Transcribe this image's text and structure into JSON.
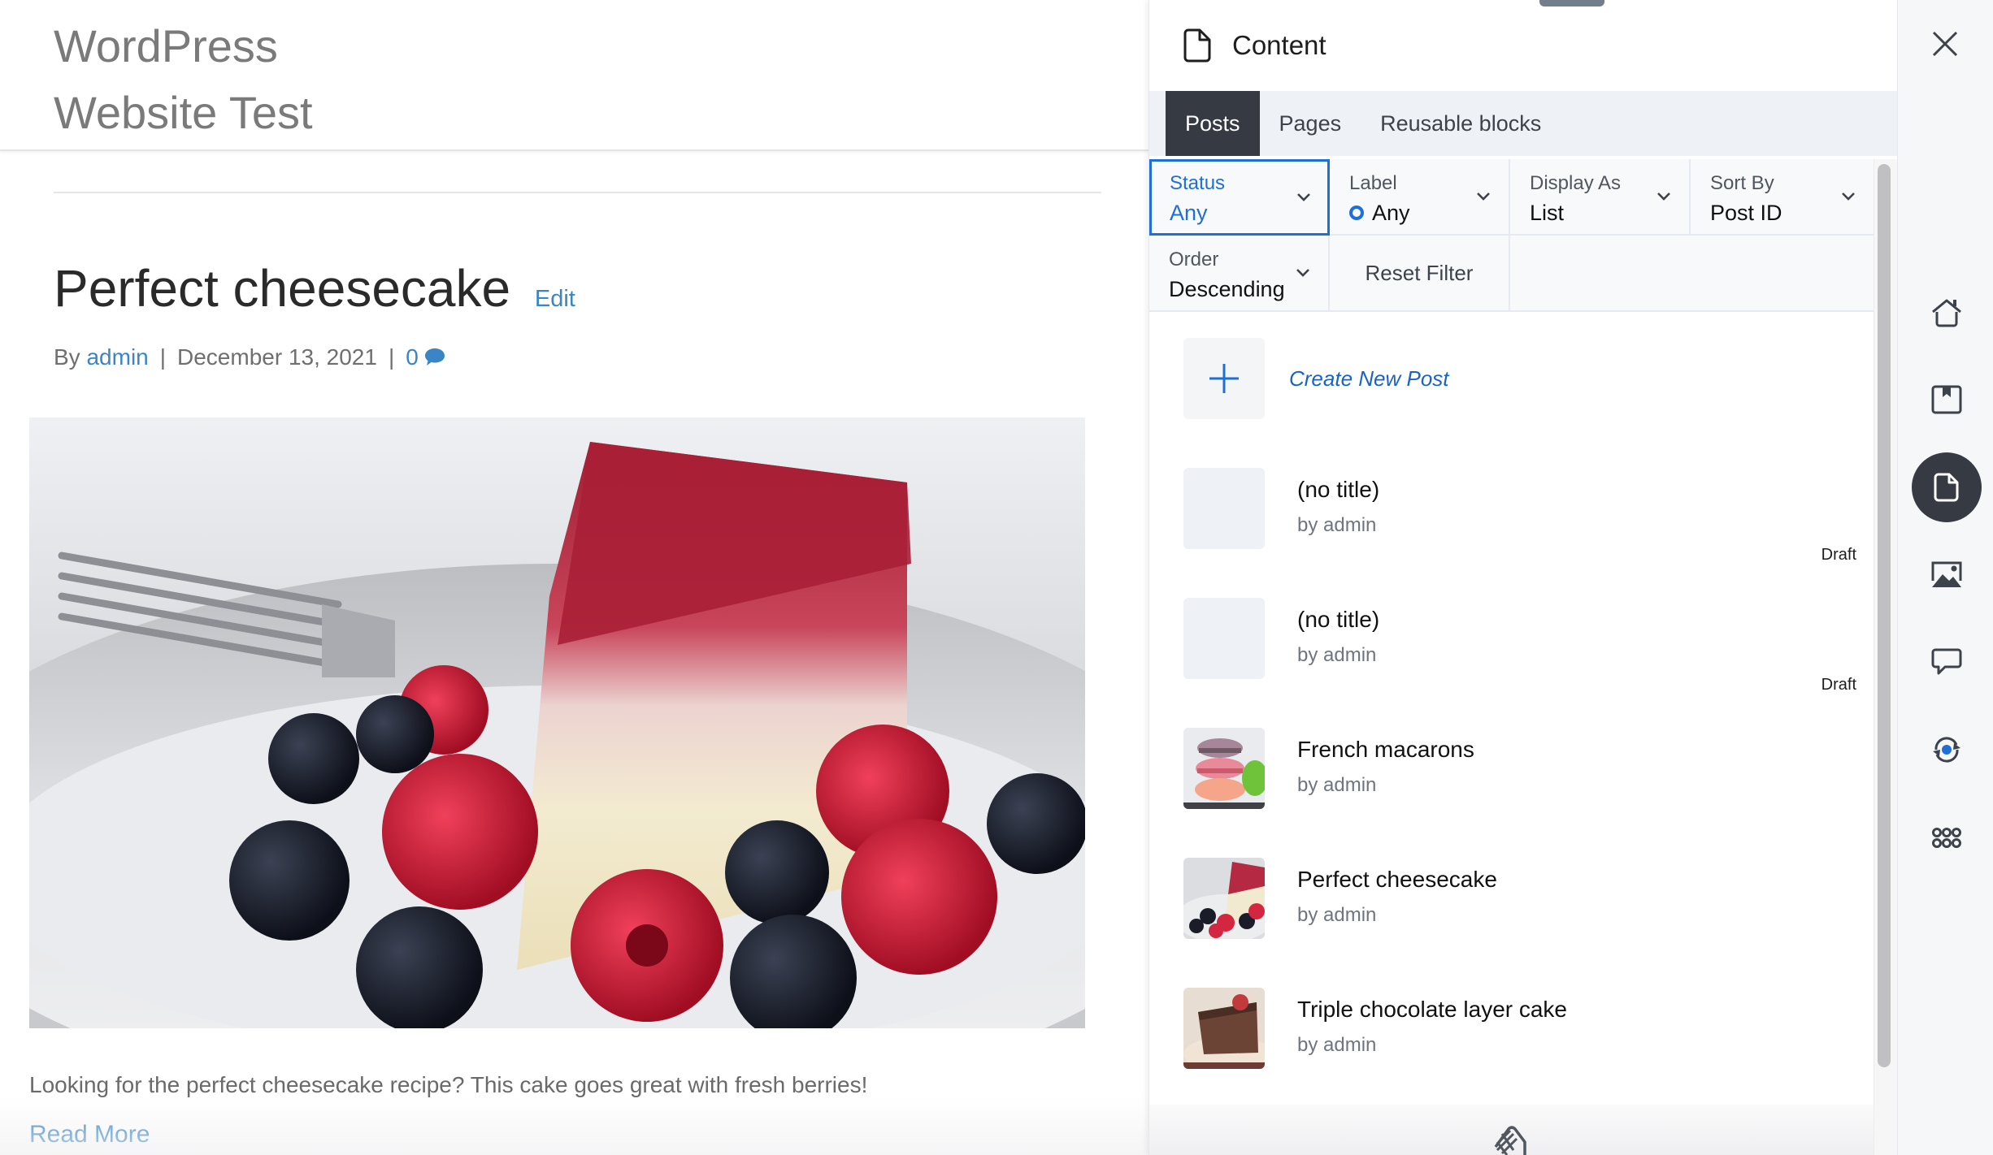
{
  "site": {
    "title_line1": "WordPress",
    "title_line2": "Website Test",
    "post": {
      "title": "Perfect cheesecake",
      "edit_label": "Edit",
      "by_label": "By",
      "author": "admin",
      "separator": "|",
      "date": "December 13, 2021",
      "comment_count": "0",
      "excerpt": "Looking for the perfect cheesecake recipe? This cake goes great with fresh berries!",
      "read_more": "Read More"
    }
  },
  "panel": {
    "title": "Content",
    "header_icon": "document-icon",
    "tabs": [
      {
        "label": "Posts",
        "active": true
      },
      {
        "label": "Pages",
        "active": false
      },
      {
        "label": "Reusable blocks",
        "active": false
      }
    ],
    "filters": {
      "status": {
        "label": "Status",
        "value": "Any"
      },
      "label": {
        "label": "Label",
        "value": "Any"
      },
      "display_as": {
        "label": "Display As",
        "value": "List"
      },
      "sort_by": {
        "label": "Sort By",
        "value": "Post ID"
      },
      "order": {
        "label": "Order",
        "value": "Descending"
      },
      "reset_label": "Reset Filter"
    },
    "create_label": "Create New Post",
    "items": [
      {
        "title": "(no title)",
        "author": "by admin",
        "status": "Draft",
        "thumbnail": "none"
      },
      {
        "title": "(no title)",
        "author": "by admin",
        "status": "Draft",
        "thumbnail": "none"
      },
      {
        "title": "French macarons",
        "author": "by admin",
        "status": "",
        "thumbnail": "macarons"
      },
      {
        "title": "Perfect cheesecake",
        "author": "by admin",
        "status": "",
        "thumbnail": "cheesecake"
      },
      {
        "title": "Triple chocolate layer cake",
        "author": "by admin",
        "status": "",
        "thumbnail": "chocolate-cake"
      }
    ]
  },
  "rail": {
    "items": [
      {
        "name": "home",
        "active": false
      },
      {
        "name": "blocks",
        "active": false
      },
      {
        "name": "content",
        "active": true
      },
      {
        "name": "media",
        "active": false
      },
      {
        "name": "comments",
        "active": false
      },
      {
        "name": "sync",
        "active": false
      },
      {
        "name": "apps",
        "active": false
      }
    ]
  },
  "colors": {
    "accent": "#1e6fd9",
    "link": "#3a85c6",
    "active_tab": "#363a42",
    "tab_bar": "#eef1f6"
  }
}
